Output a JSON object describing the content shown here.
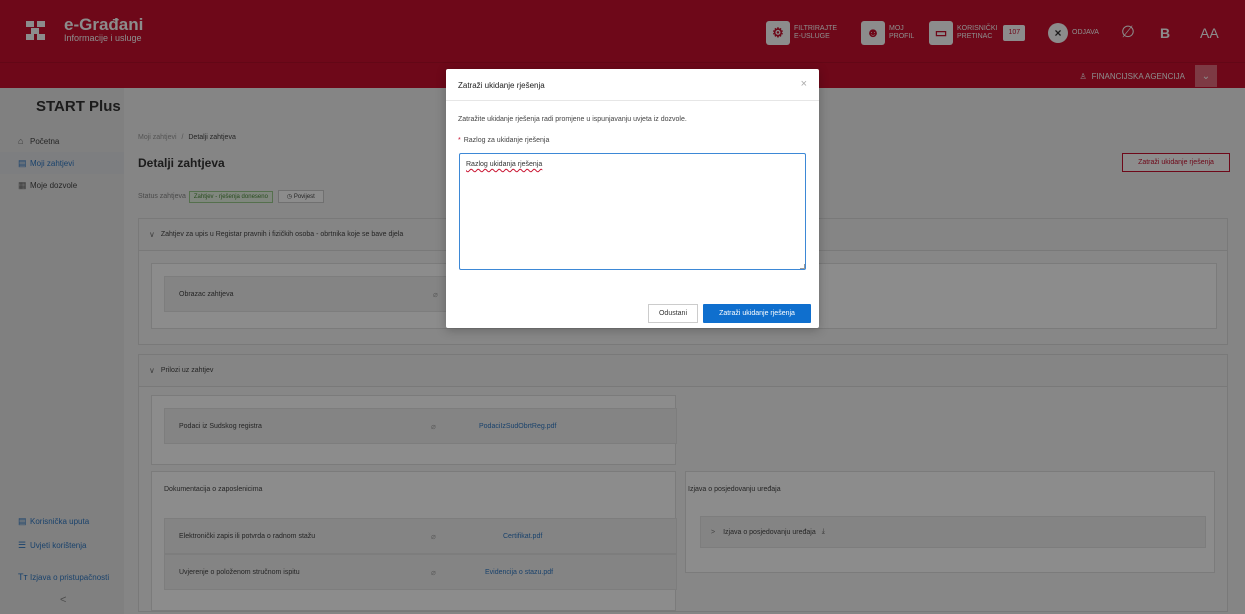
{
  "header": {
    "logo_title": "e-Građani",
    "logo_subtitle": "Informacije i usluge",
    "filter_label_1": "FILTRIRAJTE",
    "filter_label_2": "E-USLUGE",
    "profile_label_1": "MOJ",
    "profile_label_2": "PROFIL",
    "inbox_label_1": "KORISNIČKI",
    "inbox_label_2": "PRETINAC",
    "inbox_count": "107",
    "logout_label": "ODJAVA",
    "font_b_label": "B",
    "font_size_label": "AA",
    "agency_label": "FINANCIJSKA AGENCIJA"
  },
  "sidebar": {
    "brand": "START Plus",
    "items": [
      {
        "label": "Početna",
        "icon": "home-icon"
      },
      {
        "label": "Moji zahtjevi",
        "icon": "document-icon"
      },
      {
        "label": "Moje dozvole",
        "icon": "license-icon"
      }
    ],
    "bottom_items": [
      {
        "label": "Korisnička uputa",
        "icon": "manual-icon"
      },
      {
        "label": "Uvjeti korištenja",
        "icon": "list-icon"
      },
      {
        "label": "Izjava o pristupačnosti",
        "icon": "text-size-icon"
      }
    ],
    "collapse_glyph": "<"
  },
  "main": {
    "breadcrumb_root": "Moji zahtjevi",
    "breadcrumb_sep": "/",
    "breadcrumb_current": "Detalji zahtjeva",
    "title": "Detalji zahtjeva",
    "top_button": "Zatraži ukidanje rješenja",
    "status_label": "Status zahtjeva",
    "status_value": "Zahtjev - rješenja doneseno",
    "history_button": "Povijest",
    "section1_title": "Zahtjev za upis u Registar pravnih i fizičkih osoba - obrtnika koje se bave djela",
    "section1_row": "Obrazac zahtjeva",
    "section2_title": "Prilozi uz zahtjev",
    "court_label": "Podaci iz Sudskog registra",
    "court_file": "PodaciIzSudObrtReg.pdf",
    "employees_title": "Dokumentacija o zaposlenicima",
    "emp_row1_label": "Elektronički zapis ili potvrda o radnom stažu",
    "emp_row1_file": "Certifikat.pdf",
    "emp_row2_label": "Uvjerenje o položenom stručnom ispitu",
    "emp_row2_file": "Evidencija o stazu.pdf",
    "devices_title": "Izjava o posjedovanju uređaja",
    "devices_row": "Izjava o posjedovanju uređaja"
  },
  "modal": {
    "title": "Zatraži ukidanje rješenja",
    "close_glyph": "×",
    "description": "Zatražite ukidanje rješenja radi promjene u ispunjavanju uvjeta iz dozvole.",
    "required_mark": "*",
    "field_label": "Razlog za ukidanje rješenja",
    "field_value": "Razlog ukidanja rješenja",
    "cancel_button": "Odustani",
    "confirm_button": "Zatraži ukidanje rješenja"
  },
  "colors": {
    "brand_red": "#c8102e",
    "primary_blue": "#0f6fce",
    "link_blue": "#2f78c4"
  }
}
